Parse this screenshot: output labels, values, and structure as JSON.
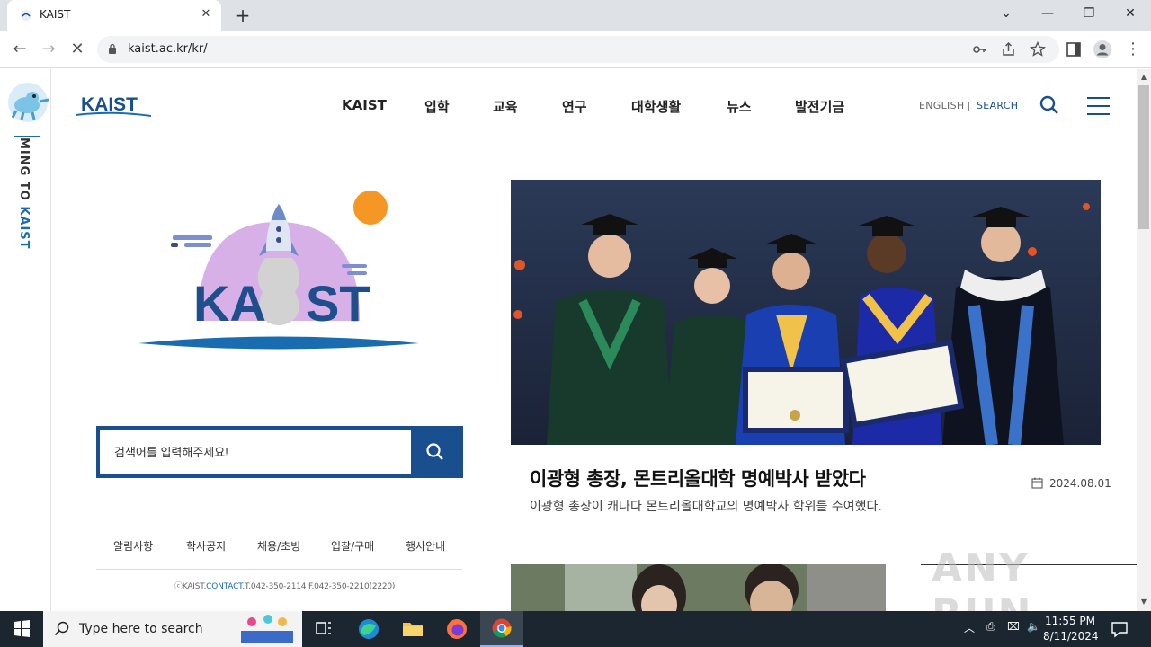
{
  "browser": {
    "tab_title": "KAIST",
    "url": "kaist.ac.kr/kr/"
  },
  "site": {
    "logo_text": "KAIST",
    "rail_text_prefix": "MING TO",
    "rail_text_kaist": "KAIST",
    "nav": [
      "KAIST",
      "입학",
      "교육",
      "연구",
      "대학생활",
      "뉴스",
      "발전기금"
    ],
    "util": {
      "english": "ENGLISH",
      "search": "SEARCH"
    },
    "search_placeholder": "검색어를 입력해주세요!",
    "quick_links": [
      "알림사항",
      "학사공지",
      "채용/초빙",
      "입찰/구매",
      "행사안내"
    ],
    "footer": {
      "prefix": "ⓒKAIST.",
      "contact": "CONTACT.",
      "rest": "T.042-350-2114 F.042-350-2210(2220)"
    },
    "news": {
      "title": "이광형 총장, 몬트리올대학 명예박사 받았다",
      "date": "2024.08.01",
      "desc": "이광형 총장이 캐나다 몬트리올대학교의 명예박사 학위를 수여했다."
    },
    "watermark": "ANY RUN"
  },
  "taskbar": {
    "search_text": "Type here to search",
    "time": "11:55 PM",
    "date": "8/11/2024"
  },
  "colors": {
    "brand": "#1a4f8f",
    "accent": "#1a6cb1"
  }
}
